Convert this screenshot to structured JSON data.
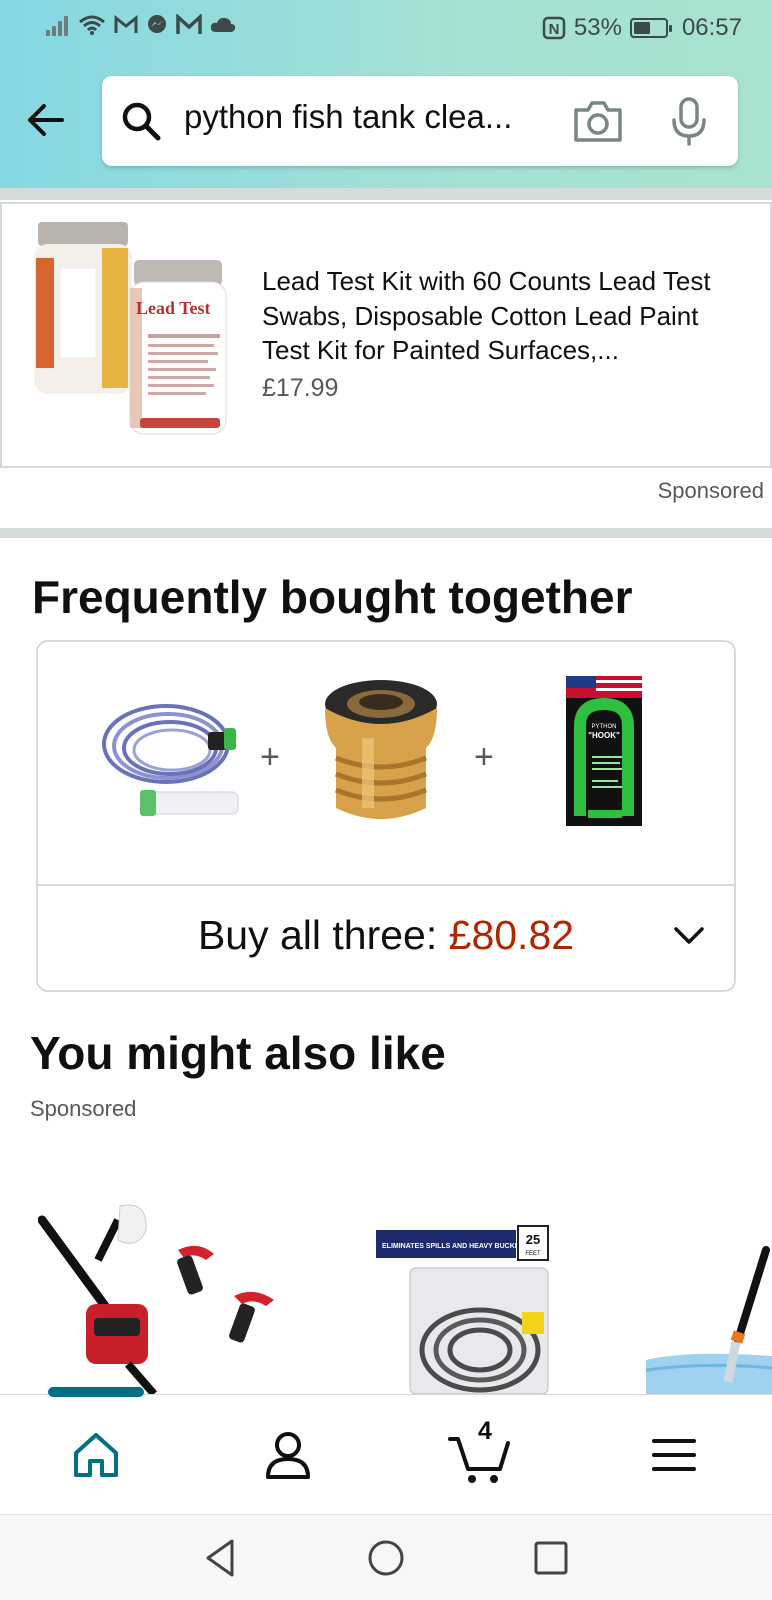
{
  "status_bar": {
    "carrier_icons": [
      "signal-icon",
      "wifi-icon",
      "gmail-icon",
      "messenger-icon",
      "gmail-icon",
      "cloud-icon"
    ],
    "nfc_label": "N",
    "battery_percent": "53%",
    "battery_level": 0.53,
    "time": "06:57"
  },
  "search": {
    "query": "python fish tank clea..."
  },
  "sponsored_product": {
    "title": "Lead Test Kit with 60 Counts Lead Test Swabs, Disposable Cotton Lead Paint Test Kit for Painted Surfaces,...",
    "price": "£17.99",
    "sponsored_label": "Sponsored",
    "image_text": "Lead Test"
  },
  "fbt": {
    "heading": "Frequently bought together",
    "plus": "+",
    "buy_label": "Buy all three: ",
    "buy_price": "£80.82",
    "hook_brand": "PYTHON",
    "hook_name": "\"HOOK\""
  },
  "ymal": {
    "heading": "You might also like",
    "sponsored_label": "Sponsored",
    "banner_text": "ELIMINATES SPILLS AND HEAVY BUCKETS",
    "feet_number": "25",
    "feet_label": "FEET"
  },
  "bottom_nav": {
    "cart_count": "4",
    "items": [
      "home-icon",
      "account-icon",
      "cart-icon",
      "menu-icon"
    ]
  },
  "colors": {
    "accent": "#007185",
    "price_red": "#b12704",
    "header_gradient_start": "#84d8e3",
    "header_gradient_end": "#a9e3cf"
  }
}
